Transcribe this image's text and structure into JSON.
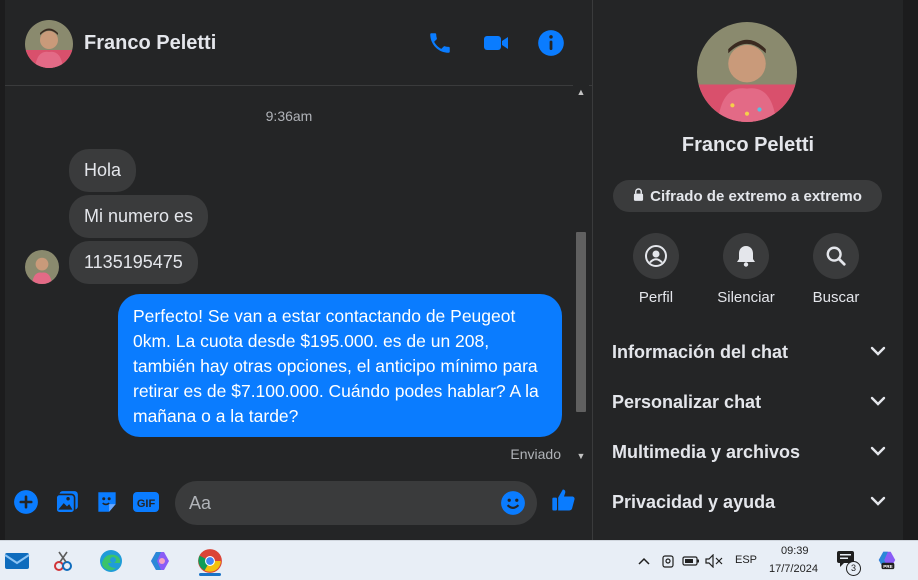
{
  "chat": {
    "contact_name": "Franco Peletti",
    "header_icons": [
      "phone-icon",
      "video-camera-icon",
      "info-icon"
    ],
    "timestamp": "9:36am",
    "incoming_messages": [
      "Hola",
      "Mi numero es",
      "1135195475"
    ],
    "outgoing_message": "Perfecto!  Se van a estar contactando de Peugeot 0km. La cuota desde $195.000. es de un 208, también hay otras opciones, el anticipo mínimo para retirar es de $7.100.000. Cuándo podes hablar? A la mañana o a la tarde?",
    "sent_status": "Enviado",
    "composer": {
      "placeholder": "Aa",
      "icons": [
        "plus-circle-icon",
        "image-icon",
        "sticker-icon",
        "gif-icon",
        "emoji-icon",
        "thumbs-up-icon"
      ]
    }
  },
  "info_panel": {
    "name": "Franco Peletti",
    "encryption_label": "Cifrado de extremo a extremo",
    "actions": [
      {
        "label": "Perfil",
        "icon": "profile-icon"
      },
      {
        "label": "Silenciar",
        "icon": "bell-icon"
      },
      {
        "label": "Buscar",
        "icon": "search-icon"
      }
    ],
    "sections": [
      "Información del chat",
      "Personalizar chat",
      "Multimedia y archivos",
      "Privacidad y ayuda"
    ]
  },
  "taskbar": {
    "apps": [
      "mail-icon",
      "snipping-tool-icon",
      "edge-icon",
      "copilot-icon",
      "chrome-icon"
    ],
    "language": "ESP",
    "time": "09:39",
    "date": "17/7/2024",
    "notification_count": "3",
    "colors": {
      "accent": "#0a7cff"
    }
  },
  "colors": {
    "background": "#242526",
    "bubble_in": "#3a3b3c",
    "bubble_out": "#0a7cff",
    "text": "#e4e6eb",
    "icon_blue": "#0a7cff"
  }
}
